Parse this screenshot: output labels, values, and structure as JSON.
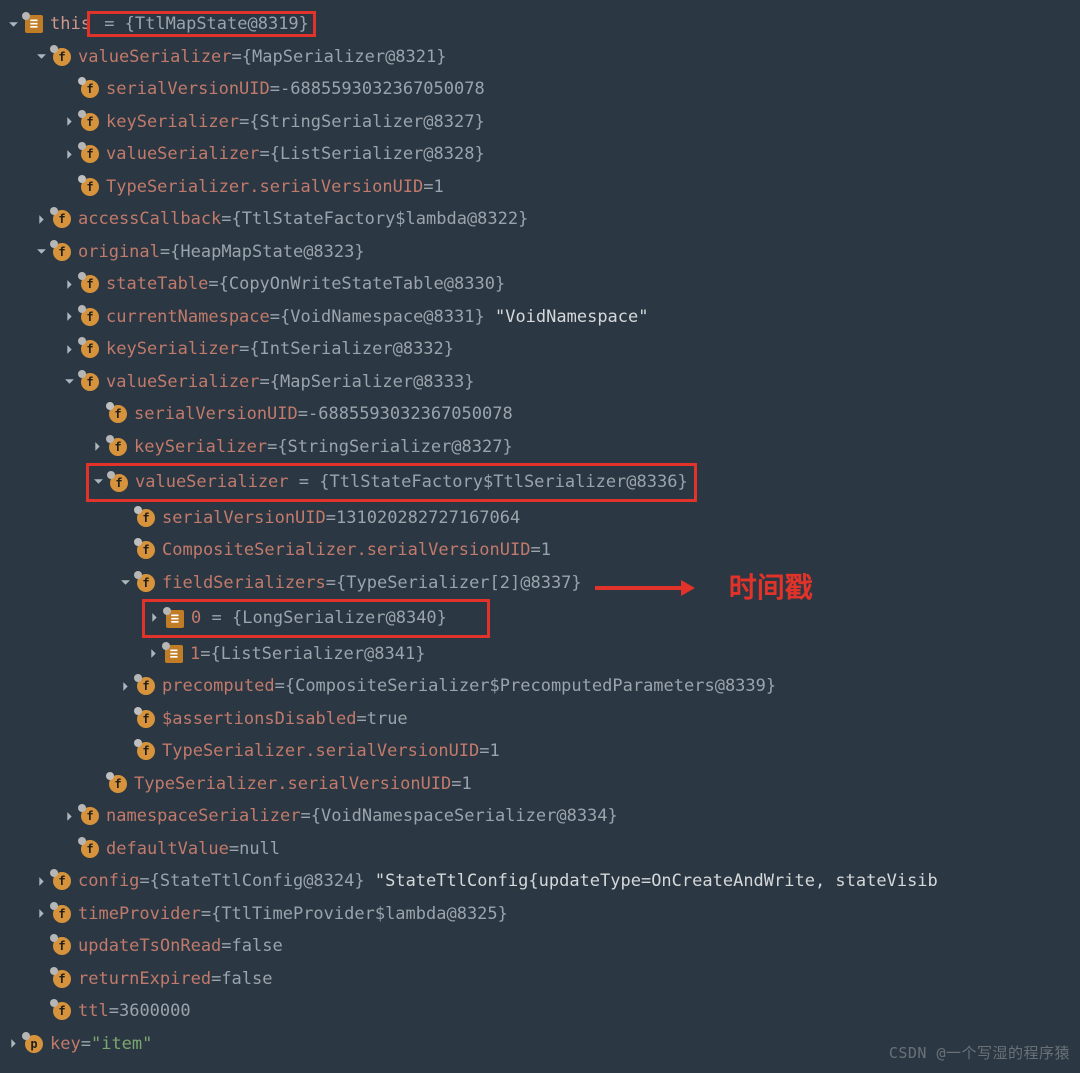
{
  "annotation": {
    "label": "时间戳"
  },
  "watermark": "CSDN @一个写湿的程序猿",
  "tree": {
    "root": {
      "name": "this",
      "sep": " = ",
      "value": "{TtlMapState@8319}",
      "children": {
        "valueSerializer": {
          "name": "valueSerializer",
          "sep": " = ",
          "value": "{MapSerializer@8321}",
          "c": {
            "svu": {
              "name": "serialVersionUID",
              "sep": " = ",
              "value": "-6885593032367050078"
            },
            "ks": {
              "name": "keySerializer",
              "sep": " = ",
              "value": "{StringSerializer@8327}"
            },
            "vs": {
              "name": "valueSerializer",
              "sep": " = ",
              "value": "{ListSerializer@8328}"
            },
            "tsu": {
              "name": "TypeSerializer.serialVersionUID",
              "sep": " = ",
              "value": "1"
            }
          }
        },
        "accessCallback": {
          "name": "accessCallback",
          "sep": " = ",
          "value": "{TtlStateFactory$lambda@8322}"
        },
        "original": {
          "name": "original",
          "sep": " = ",
          "value": "{HeapMapState@8323}",
          "c": {
            "st": {
              "name": "stateTable",
              "sep": " = ",
              "value": "{CopyOnWriteStateTable@8330}"
            },
            "cn": {
              "name": "currentNamespace",
              "sep": " = ",
              "value": "{VoidNamespace@8331}",
              "str": "\"VoidNamespace\""
            },
            "ks": {
              "name": "keySerializer",
              "sep": " = ",
              "value": "{IntSerializer@8332}"
            },
            "vs": {
              "name": "valueSerializer",
              "sep": " = ",
              "value": "{MapSerializer@8333}",
              "c": {
                "svu": {
                  "name": "serialVersionUID",
                  "sep": " = ",
                  "value": "-6885593032367050078"
                },
                "ks": {
                  "name": "keySerializer",
                  "sep": " = ",
                  "value": "{StringSerializer@8327}"
                },
                "vs": {
                  "name": "valueSerializer",
                  "sep": " = ",
                  "value": "{TtlStateFactory$TtlSerializer@8336}",
                  "c": {
                    "svu": {
                      "name": "serialVersionUID",
                      "sep": " = ",
                      "value": "131020282727167064"
                    },
                    "csu": {
                      "name": "CompositeSerializer.serialVersionUID",
                      "sep": " = ",
                      "value": "1"
                    },
                    "fs": {
                      "name": "fieldSerializers",
                      "sep": " = ",
                      "value": "{TypeSerializer[2]@8337}",
                      "c": {
                        "i0": {
                          "name": "0",
                          "sep": " = ",
                          "value": "{LongSerializer@8340}"
                        },
                        "i1": {
                          "name": "1",
                          "sep": " = ",
                          "value": "{ListSerializer@8341}"
                        }
                      }
                    },
                    "pc": {
                      "name": "precomputed",
                      "sep": " = ",
                      "value": "{CompositeSerializer$PrecomputedParameters@8339}"
                    },
                    "ad": {
                      "name": "$assertionsDisabled",
                      "sep": " = ",
                      "value": "true"
                    },
                    "tsu": {
                      "name": "TypeSerializer.serialVersionUID",
                      "sep": " = ",
                      "value": "1"
                    }
                  }
                },
                "tsu": {
                  "name": "TypeSerializer.serialVersionUID",
                  "sep": " = ",
                  "value": "1"
                }
              }
            },
            "ns": {
              "name": "namespaceSerializer",
              "sep": " = ",
              "value": "{VoidNamespaceSerializer@8334}"
            },
            "dv": {
              "name": "defaultValue",
              "sep": " = ",
              "value": "null"
            }
          }
        },
        "config": {
          "name": "config",
          "sep": " = ",
          "value": "{StateTtlConfig@8324}",
          "str": "\"StateTtlConfig{updateType=OnCreateAndWrite, stateVisib"
        },
        "timeProvider": {
          "name": "timeProvider",
          "sep": " = ",
          "value": "{TtlTimeProvider$lambda@8325}"
        },
        "updateTsOnRead": {
          "name": "updateTsOnRead",
          "sep": " = ",
          "value": "false"
        },
        "returnExpired": {
          "name": "returnExpired",
          "sep": " = ",
          "value": "true"
        },
        "ttl": {
          "name": "ttl",
          "sep": " = ",
          "value": "3600000"
        }
      }
    },
    "key": {
      "name": "key",
      "sep": " = ",
      "value": "\"item\""
    }
  },
  "returnExpiredDisplay": "false"
}
